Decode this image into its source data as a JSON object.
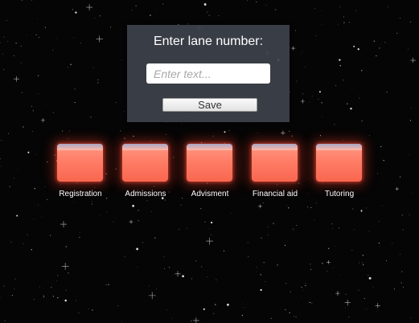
{
  "dialog": {
    "title": "Enter lane number:",
    "input_value": "",
    "input_placeholder": "Enter text...",
    "save_label": "Save"
  },
  "lanes": [
    {
      "label": "Registration"
    },
    {
      "label": "Admissions"
    },
    {
      "label": "Advisment"
    },
    {
      "label": "Financial aid"
    },
    {
      "label": "Tutoring"
    }
  ],
  "colors": {
    "background": "#050505",
    "cube": "#ff7d66",
    "cube_glow": "#ff3c28",
    "dialog_panel": "#3e424c"
  }
}
